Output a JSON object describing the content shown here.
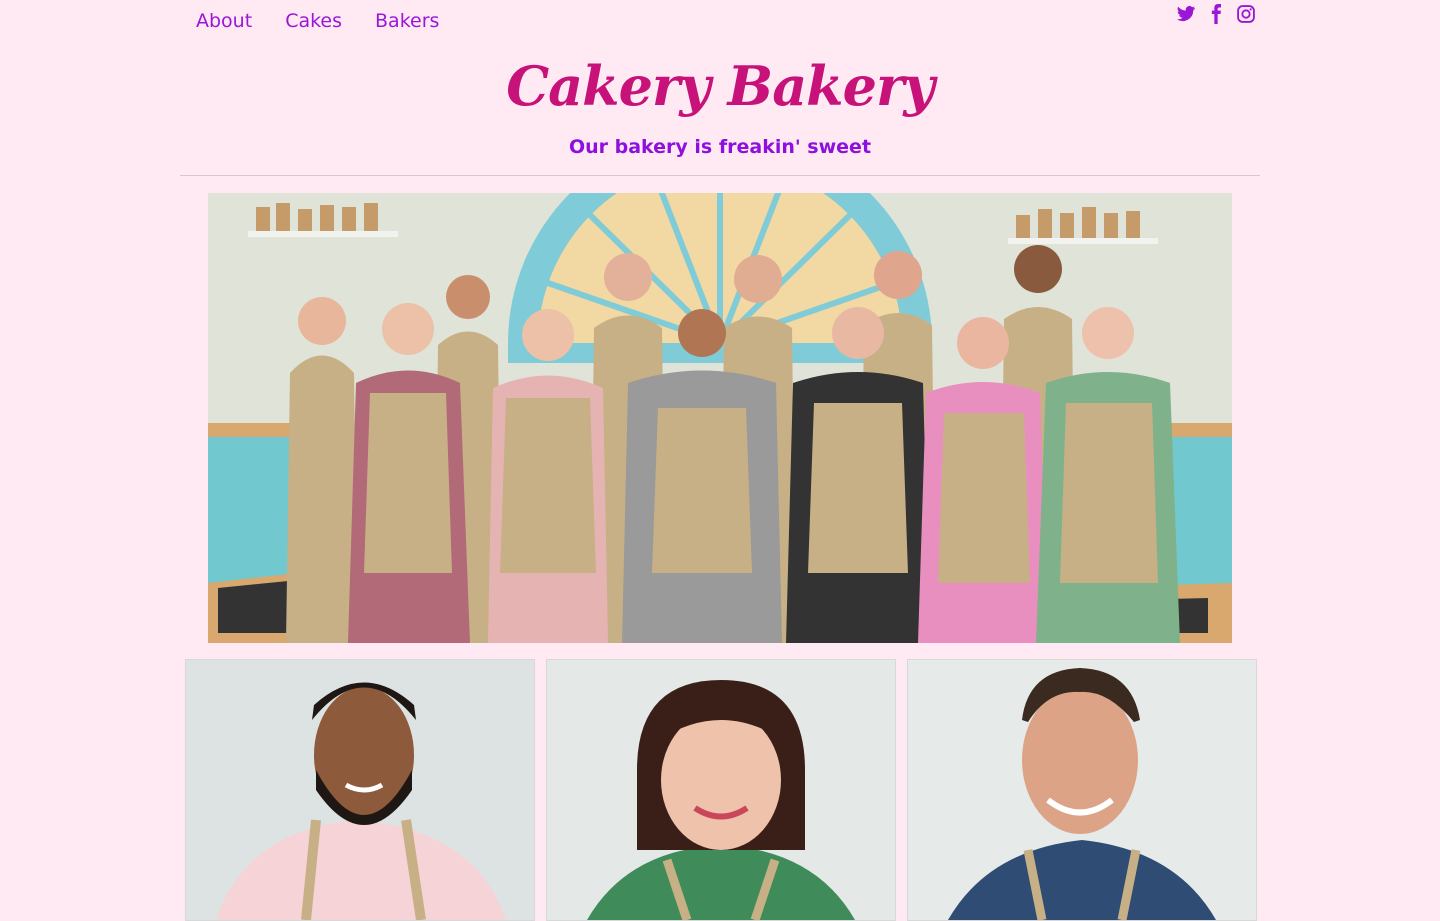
{
  "nav": {
    "items": [
      {
        "label": "About"
      },
      {
        "label": "Cakes"
      },
      {
        "label": "Bakers"
      }
    ]
  },
  "social": {
    "icons": [
      "twitter-icon",
      "facebook-icon",
      "instagram-icon"
    ],
    "color": "#9b16d6"
  },
  "header": {
    "brand": "Cakery Bakery",
    "tagline": "Our bakery is freakin' sweet"
  },
  "hero": {
    "description_icon": "bakers-group-photo"
  },
  "cards": [
    {
      "photo": "baker-portrait-1"
    },
    {
      "photo": "baker-portrait-2"
    },
    {
      "photo": "baker-portrait-3"
    }
  ],
  "colors": {
    "background": "#ffeaf3",
    "brand": "#c7127a",
    "accent": "#9b16d6"
  }
}
